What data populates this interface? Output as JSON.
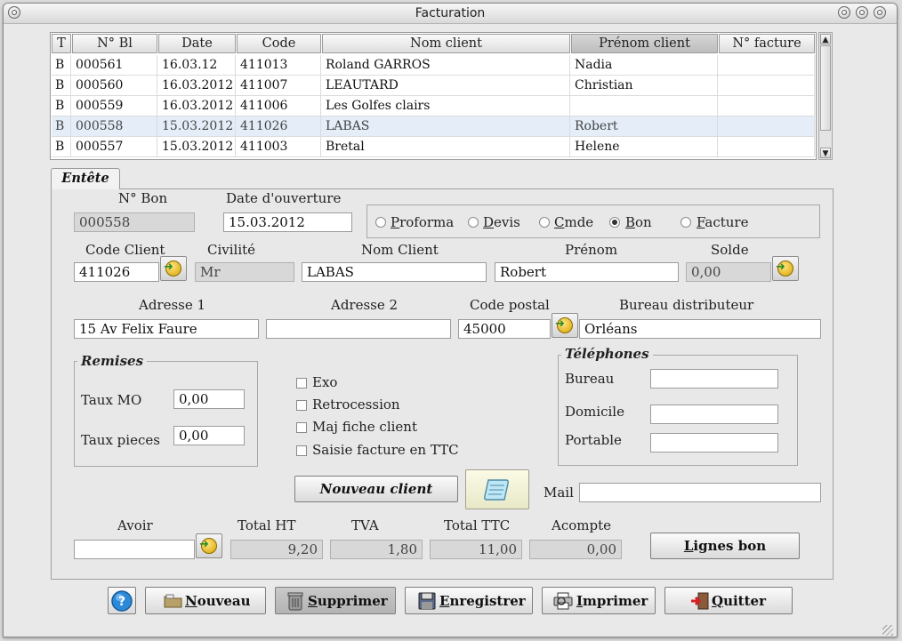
{
  "window": {
    "title": "Facturation"
  },
  "table": {
    "headers": [
      "T",
      "N° Bl",
      "Date",
      "Code",
      "Nom client",
      "Prénom client",
      "N° facture"
    ],
    "rows": [
      [
        "B",
        "000561",
        "16.03.12",
        "411013",
        "Roland GARROS",
        "Nadia",
        ""
      ],
      [
        "B",
        "000560",
        "16.03.2012",
        "411007",
        "LEAUTARD",
        "Christian",
        ""
      ],
      [
        "B",
        "000559",
        "16.03.2012",
        "411006",
        "Les Golfes clairs",
        "",
        ""
      ],
      [
        "B",
        "000558",
        "15.03.2012",
        "411026",
        "LABAS",
        "Robert",
        ""
      ],
      [
        "B",
        "000557",
        "15.03.2012",
        "411003",
        "Bretal",
        "Helene",
        ""
      ]
    ],
    "selected_row": 3,
    "sorted_column": "Prénom client"
  },
  "tab": {
    "label": "Entête"
  },
  "form": {
    "num_bon_label": "N° Bon",
    "num_bon_value": "000558",
    "date_label": "Date d'ouverture",
    "date_value": "15.03.2012",
    "doc_types": [
      {
        "label": "Proforma",
        "checked": false
      },
      {
        "label": "Devis",
        "checked": false
      },
      {
        "label": "Cmde",
        "checked": false
      },
      {
        "label": "Bon",
        "checked": true
      },
      {
        "label": "Facture",
        "checked": false
      }
    ],
    "code_client_label": "Code Client",
    "code_client_value": "411026",
    "civilite_label": "Civilité",
    "civilite_value": "Mr",
    "nom_label": "Nom Client",
    "nom_value": "LABAS",
    "prenom_label": "Prénom",
    "prenom_value": "Robert",
    "solde_label": "Solde",
    "solde_value": "0,00",
    "adresse1_label": "Adresse 1",
    "adresse1_value": "15 Av Felix Faure",
    "adresse2_label": "Adresse 2",
    "adresse2_value": "",
    "cp_label": "Code postal",
    "cp_value": "45000",
    "bureau_label": "Bureau distributeur",
    "bureau_value": "Orléans"
  },
  "remises": {
    "title": "Remises",
    "taux_mo_label": "Taux MO",
    "taux_mo_value": "0,00",
    "taux_pieces_label": "Taux pieces",
    "taux_pieces_value": "0,00"
  },
  "options": [
    {
      "label": "Exo",
      "checked": false
    },
    {
      "label": "Retrocession",
      "checked": false
    },
    {
      "label": "Maj fiche client",
      "checked": false
    },
    {
      "label": "Saisie facture en TTC",
      "checked": false
    }
  ],
  "telephones": {
    "title": "Téléphones",
    "bureau_label": "Bureau",
    "bureau_value": "",
    "domicile_label": "Domicile",
    "domicile_value": "",
    "portable_label": "Portable",
    "portable_value": ""
  },
  "nouveau_client_label": "Nouveau client",
  "mail_label": "Mail",
  "mail_value": "",
  "totals": {
    "avoir_label": "Avoir",
    "avoir_value": "",
    "total_ht_label": "Total HT",
    "total_ht_value": "9,20",
    "tva_label": "TVA",
    "tva_value": "1,80",
    "total_ttc_label": "Total TTC",
    "total_ttc_value": "11,00",
    "acompte_label": "Acompte",
    "acompte_value": "0,00",
    "lignes_bon_label": "Lignes bon"
  },
  "toolbar": {
    "nouveau": "Nouveau",
    "supprimer": "Supprimer",
    "enregistrer": "Enregistrer",
    "imprimer": "Imprimer",
    "quitter": "Quitter"
  },
  "icons": [
    "help-icon",
    "folder-icon",
    "trash-icon",
    "floppy-disk-icon",
    "printer-icon",
    "exit-door-icon",
    "arrow-go-icon",
    "scroll-note-icon"
  ]
}
